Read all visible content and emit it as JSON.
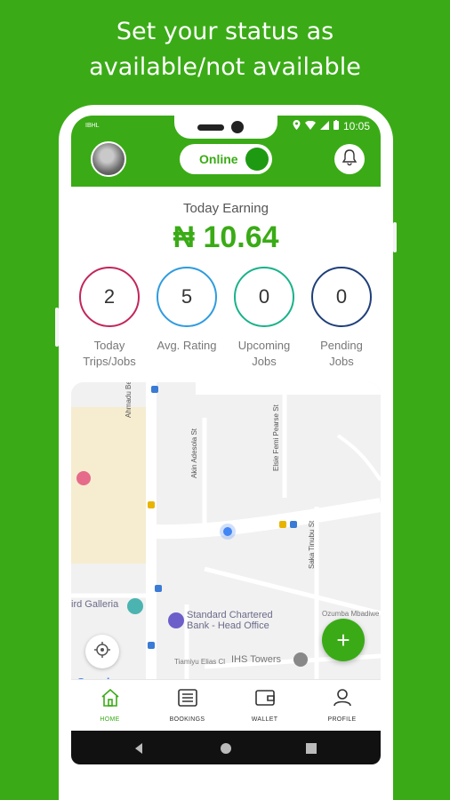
{
  "headline": {
    "line1": "Set your status as",
    "line2": "available/not available"
  },
  "status_bar": {
    "carrier": "IBHL",
    "time": "10:05"
  },
  "header": {
    "status_toggle_label": "Online",
    "status_toggle_on": true,
    "avatar_icon": "user-avatar",
    "bell_icon": "bell-icon"
  },
  "earnings": {
    "title": "Today Earning",
    "value": "₦ 10.64"
  },
  "stats": [
    {
      "value": "2",
      "label_line1": "Today",
      "label_line2": "Trips/Jobs",
      "color": "#c2265a"
    },
    {
      "value": "5",
      "label_line1": "Avg. Rating",
      "label_line2": "",
      "color": "#2f9be0"
    },
    {
      "value": "0",
      "label_line1": "Upcoming",
      "label_line2": "Jobs",
      "color": "#19b28a"
    },
    {
      "value": "0",
      "label_line1": "Pending",
      "label_line2": "Jobs",
      "color": "#1f3f7a"
    }
  ],
  "map": {
    "labels": {
      "road1": "Ahmadu Bello Way",
      "road2": "Akin Adesola St",
      "road3": "Elsie Femi Pearse St",
      "road4": "Saka Tinubu St",
      "gallery": "ird Galleria",
      "bank_line1": "Standard Chartered",
      "bank_line2": "Bank - Head Office",
      "road5": "Tiamiyu Elias Cl",
      "towers": "IHS Towers",
      "road6": "Ozumba Mbadiwe",
      "google": "Google"
    }
  },
  "bottom_nav": [
    {
      "label": "HOME",
      "icon": "home-icon",
      "active": true
    },
    {
      "label": "BOOKINGS",
      "icon": "list-icon",
      "active": false
    },
    {
      "label": "WALLET",
      "icon": "wallet-icon",
      "active": false
    },
    {
      "label": "PROFILE",
      "icon": "profile-icon",
      "active": false
    }
  ],
  "colors": {
    "brand_green": "#3aab16",
    "accent_green": "#1e9a12"
  }
}
